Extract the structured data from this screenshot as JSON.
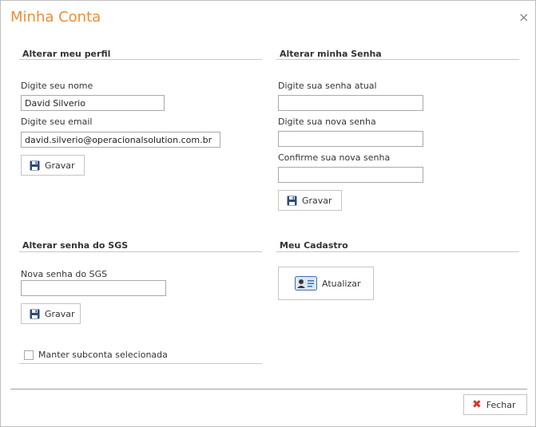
{
  "window": {
    "title": "Minha Conta",
    "close_glyph": "×"
  },
  "perfil": {
    "title": "Alterar meu perfil",
    "name_label": "Digite seu nome",
    "name_value": "David Silverio",
    "email_label": "Digite seu email",
    "email_value": "david.silverio@operacionalsolution.com.br",
    "save_label": "Gravar"
  },
  "senha": {
    "title": "Alterar minha Senha",
    "current_label": "Digite sua senha atual",
    "new_label": "Digite sua nova senha",
    "confirm_label": "Confirme sua nova senha",
    "save_label": "Gravar"
  },
  "sgs": {
    "title": "Alterar senha do SGS",
    "password_label": "Nova senha do SGS",
    "save_label": "Gravar",
    "checkbox_label": "Manter subconta selecionada",
    "checkbox_checked": false
  },
  "cadastro": {
    "title": "Meu Cadastro",
    "update_label": "Atualizar"
  },
  "footer": {
    "close_label": "Fechar"
  },
  "icons": {
    "save": "floppy-disk-icon",
    "update": "contact-card-icon",
    "close": "red-x-icon"
  },
  "colors": {
    "title": "#f08c33",
    "close_x": "#d9342b"
  }
}
